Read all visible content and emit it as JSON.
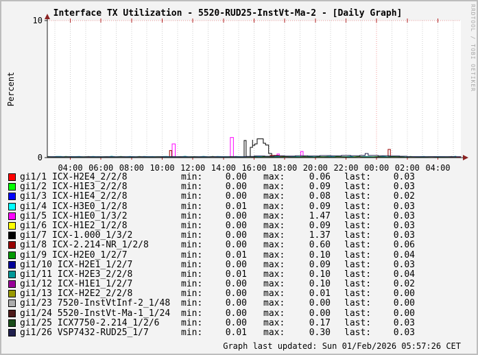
{
  "window": {
    "watermark": "RRDTOOL / TOBI OETIKER",
    "footer": "Graph last updated: Sun 01/Feb/2026 05:57:26 CET"
  },
  "chart_data": {
    "type": "line",
    "title": "Interface TX Utilization - 5520-RUD25-InstVt-Ma-2 - [Daily Graph]",
    "ylabel": "Percent",
    "ylim": [
      0,
      10
    ],
    "y_ticks": [
      "10",
      "0"
    ],
    "x_range_hours": 27,
    "x_ticks": [
      {
        "t": 1.5,
        "label": "04:00"
      },
      {
        "t": 3.5,
        "label": "06:00"
      },
      {
        "t": 5.5,
        "label": "08:00"
      },
      {
        "t": 7.5,
        "label": "10:00"
      },
      {
        "t": 9.5,
        "label": "12:00"
      },
      {
        "t": 11.5,
        "label": "14:00"
      },
      {
        "t": 13.5,
        "label": "16:00"
      },
      {
        "t": 15.5,
        "label": "18:00"
      },
      {
        "t": 17.5,
        "label": "20:00"
      },
      {
        "t": 19.5,
        "label": "22:00"
      },
      {
        "t": 21.5,
        "label": "00:00"
      },
      {
        "t": 23.5,
        "label": "02:00"
      },
      {
        "t": 25.5,
        "label": "04:00"
      }
    ],
    "midnight_t": 21.5,
    "legend_columns": {
      "min": "min:",
      "max": "max:",
      "last": "last:"
    },
    "series": [
      {
        "port": "gi1/1",
        "name": "ICX-H2E4_2/2/8",
        "color": "#ff0000",
        "base": 0.03,
        "min": "0.00",
        "max": "0.06",
        "last": "0.03"
      },
      {
        "port": "gi1/2",
        "name": "ICX-H1E3_2/2/8",
        "color": "#00ff00",
        "base": 0.04,
        "min": "0.00",
        "max": "0.09",
        "last": "0.03"
      },
      {
        "port": "gi1/3",
        "name": "ICX-H1E4_2/2/8",
        "color": "#0000ff",
        "base": 0.03,
        "min": "0.00",
        "max": "0.08",
        "last": "0.02"
      },
      {
        "port": "gi1/4",
        "name": "ICX-H3E0_1/2/8",
        "color": "#00ffff",
        "base": 0.05,
        "min": "0.01",
        "max": "0.09",
        "last": "0.03"
      },
      {
        "port": "gi1/5",
        "name": "ICX-H1E0_1/3/2",
        "color": "#ff00ff",
        "base": 0.03,
        "min": "0.00",
        "max": "1.47",
        "last": "0.03",
        "points": [
          [
            0,
            0.03
          ],
          [
            8.15,
            0.03
          ],
          [
            8.15,
            1.0
          ],
          [
            8.35,
            1.0
          ],
          [
            8.35,
            0.05
          ],
          [
            11.95,
            0.05
          ],
          [
            11.95,
            1.47
          ],
          [
            12.15,
            1.47
          ],
          [
            12.15,
            0.04
          ],
          [
            15.0,
            0.04
          ],
          [
            15.0,
            0.26
          ],
          [
            15.15,
            0.26
          ],
          [
            15.15,
            0.04
          ],
          [
            16.55,
            0.04
          ],
          [
            16.55,
            0.45
          ],
          [
            16.7,
            0.45
          ],
          [
            16.7,
            0.03
          ],
          [
            27,
            0.03
          ]
        ]
      },
      {
        "port": "gi1/6",
        "name": "ICX-H1E2_1/2/8",
        "color": "#ffff00",
        "base": 0.03,
        "min": "0.00",
        "max": "0.09",
        "last": "0.03"
      },
      {
        "port": "gi1/7",
        "name": "ICX-1.000_1/3/2",
        "color": "#000000",
        "base": 0.04,
        "min": "0.00",
        "max": "1.37",
        "last": "0.03",
        "points": [
          [
            0,
            0.04
          ],
          [
            12.85,
            0.04
          ],
          [
            12.85,
            1.25
          ],
          [
            12.98,
            1.25
          ],
          [
            12.98,
            0.06
          ],
          [
            13.25,
            0.06
          ],
          [
            13.25,
            0.75
          ],
          [
            13.4,
            1.3
          ],
          [
            13.4,
            0.9
          ],
          [
            13.55,
            0.9
          ],
          [
            13.55,
            1.0
          ],
          [
            13.7,
            1.0
          ],
          [
            13.7,
            1.37
          ],
          [
            14.1,
            1.37
          ],
          [
            14.1,
            1.05
          ],
          [
            14.25,
            1.05
          ],
          [
            14.25,
            0.92
          ],
          [
            14.45,
            0.92
          ],
          [
            14.45,
            0.3
          ],
          [
            14.65,
            0.3
          ],
          [
            14.65,
            0.05
          ],
          [
            27,
            0.05
          ]
        ]
      },
      {
        "port": "gi1/8",
        "name": "ICX-2.214-NR_1/2/8",
        "color": "#990000",
        "base": 0.03,
        "min": "0.00",
        "max": "0.60",
        "last": "0.06",
        "points": [
          [
            0,
            0.03
          ],
          [
            7.98,
            0.03
          ],
          [
            7.98,
            0.52
          ],
          [
            8.12,
            0.52
          ],
          [
            8.12,
            0.04
          ],
          [
            14.55,
            0.04
          ],
          [
            14.55,
            0.16
          ],
          [
            15.1,
            0.16
          ],
          [
            15.1,
            0.1
          ],
          [
            15.7,
            0.1
          ],
          [
            15.7,
            0.04
          ],
          [
            22.25,
            0.04
          ],
          [
            22.25,
            0.6
          ],
          [
            22.4,
            0.6
          ],
          [
            22.4,
            0.04
          ],
          [
            27,
            0.04
          ]
        ]
      },
      {
        "port": "gi1/9",
        "name": "ICX-H2E0_1/2/7",
        "color": "#009900",
        "base": 0.06,
        "min": "0.01",
        "max": "0.10",
        "last": "0.04"
      },
      {
        "port": "gi1/10",
        "name": "ICX-H2E1_1/2/7",
        "color": "#000099",
        "base": 0.04,
        "min": "0.00",
        "max": "0.09",
        "last": "0.03"
      },
      {
        "port": "gi1/11",
        "name": "ICX-H2E3_2/2/8",
        "color": "#009898",
        "base": 0.07,
        "min": "0.01",
        "max": "0.10",
        "last": "0.04"
      },
      {
        "port": "gi1/12",
        "name": "ICX-H1E1_1/2/7",
        "color": "#990099",
        "base": 0.03,
        "min": "0.00",
        "max": "0.10",
        "last": "0.02"
      },
      {
        "port": "gi1/13",
        "name": "ICX-H2E2_2/2/8",
        "color": "#999900",
        "base": 0.02,
        "min": "0.00",
        "max": "0.01",
        "last": "0.00"
      },
      {
        "port": "gi1/23",
        "name": "7520-InstVtInf-2_1/48",
        "color": "#acacac",
        "base": 0.01,
        "min": "0.00",
        "max": "0.00",
        "last": "0.00"
      },
      {
        "port": "gi1/24",
        "name": "5520-InstVt-Ma-1_1/24",
        "color": "#4d1a1a",
        "base": 0.01,
        "min": "0.00",
        "max": "0.00",
        "last": "0.00"
      },
      {
        "port": "gi1/25",
        "name": "ICX7750-2.214_1/2/6",
        "color": "#1a4d1a",
        "base": 0.05,
        "min": "0.00",
        "max": "0.17",
        "last": "0.03"
      },
      {
        "port": "gi1/26",
        "name": "VSP7432-RUD25_1/7",
        "color": "#20204d",
        "base": 0.06,
        "min": "0.01",
        "max": "0.30",
        "last": "0.03",
        "points": [
          [
            0,
            0.06
          ],
          [
            12.5,
            0.06
          ],
          [
            13.0,
            0.09
          ],
          [
            13.5,
            0.12
          ],
          [
            14.2,
            0.1
          ],
          [
            14.8,
            0.13
          ],
          [
            15.5,
            0.11
          ],
          [
            16.2,
            0.14
          ],
          [
            17.0,
            0.12
          ],
          [
            17.8,
            0.15
          ],
          [
            18.5,
            0.13
          ],
          [
            19.2,
            0.16
          ],
          [
            19.8,
            0.14
          ],
          [
            20.4,
            0.16
          ],
          [
            20.75,
            0.3
          ],
          [
            20.95,
            0.3
          ],
          [
            20.95,
            0.16
          ],
          [
            21.6,
            0.14
          ],
          [
            22.3,
            0.12
          ],
          [
            23.0,
            0.1
          ],
          [
            23.5,
            0.07
          ],
          [
            27,
            0.06
          ]
        ]
      }
    ],
    "colors": {
      "grid_minor": "#cccccc",
      "grid_major": "#f09898",
      "axis": "#1c1c1c",
      "arrow": "#8b2323",
      "tick_red": "#b22222",
      "canvas": "#ffffff",
      "background": "#f3f3f3"
    }
  }
}
